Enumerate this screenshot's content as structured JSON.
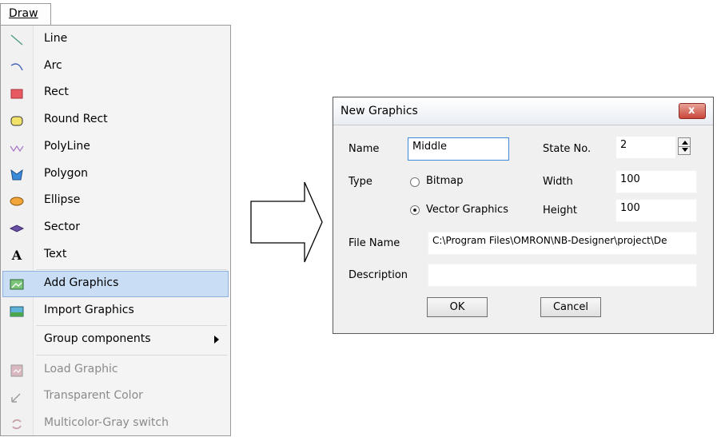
{
  "menu": {
    "title": "Draw",
    "items": [
      {
        "label": "Line",
        "icon": "line-icon"
      },
      {
        "label": "Arc",
        "icon": "arc-icon"
      },
      {
        "label": "Rect",
        "icon": "rect-icon"
      },
      {
        "label": "Round Rect",
        "icon": "round-rect-icon"
      },
      {
        "label": "PolyLine",
        "icon": "polyline-icon"
      },
      {
        "label": "Polygon",
        "icon": "polygon-icon"
      },
      {
        "label": "Ellipse",
        "icon": "ellipse-icon"
      },
      {
        "label": "Sector",
        "icon": "sector-icon"
      },
      {
        "label": "Text",
        "icon": "text-icon"
      },
      {
        "label": "Add Graphics",
        "icon": "add-graphics-icon",
        "highlighted": true
      },
      {
        "label": "Import Graphics",
        "icon": "import-graphics-icon"
      },
      {
        "label": "Group components",
        "icon": "submenu-arrow-icon"
      },
      {
        "label": "Load Graphic",
        "icon": "load-graphic-icon",
        "disabled": true
      },
      {
        "label": "Transparent Color",
        "icon": "transparent-color-icon",
        "disabled": true
      },
      {
        "label": "Multicolor-Gray switch",
        "icon": "multicolor-gray-icon",
        "disabled": true
      }
    ],
    "highlight_color": "#c9def5"
  },
  "dialog": {
    "title": "New Graphics",
    "close_label": "x",
    "name_label": "Name",
    "name_value": "Middle",
    "state_label": "State No.",
    "state_value": "2",
    "type_label": "Type",
    "radio_bitmap": "Bitmap",
    "radio_vector": "Vector Graphics",
    "selected_type": "Vector Graphics",
    "width_label": "Width",
    "width_value": "100",
    "height_label": "Height",
    "height_value": "100",
    "file_label": "File Name",
    "file_value": "C:\\Program Files\\OMRON\\NB-Designer\\project\\De",
    "desc_label": "Description",
    "desc_value": "",
    "ok_label": "OK",
    "cancel_label": "Cancel"
  }
}
